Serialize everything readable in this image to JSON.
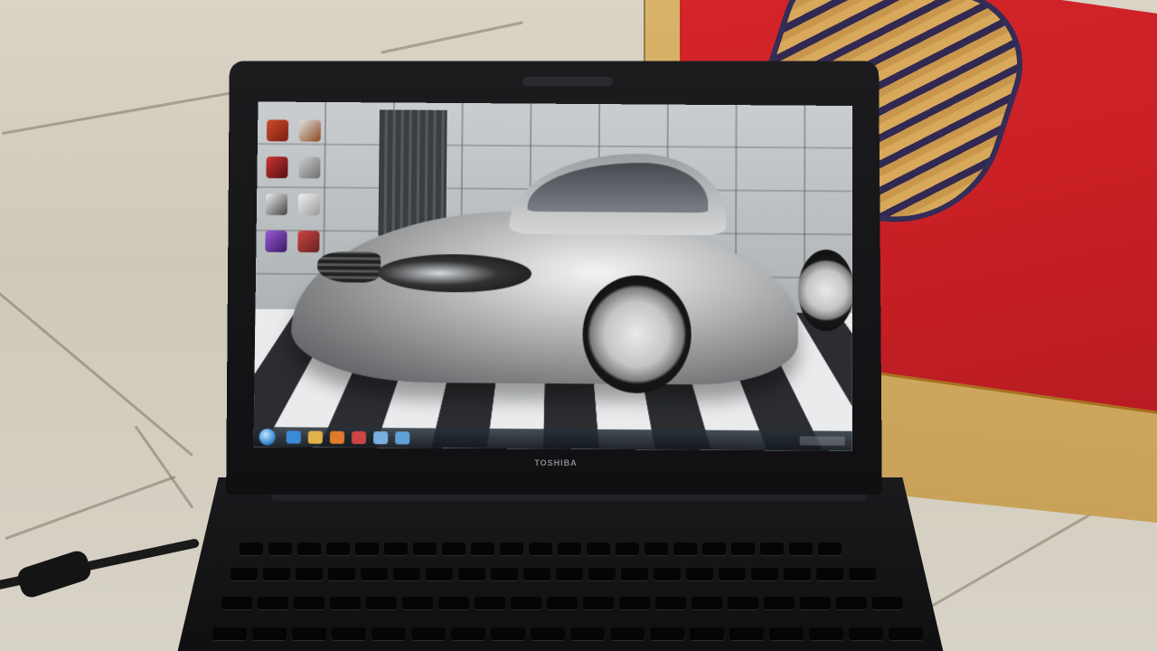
{
  "photo": {
    "subject": "laptop-displaying-car-wallpaper",
    "laptop_brand_text": "TOSHIBA"
  },
  "colors": {
    "box_red": "#c81f25",
    "box_tan": "#d2ad63",
    "floor": "#d4cfc2",
    "laptop_black": "#141416",
    "car_silver": "#b9babb",
    "taskbar": "#1c232b"
  },
  "desktop": {
    "icons": [
      "app-icon",
      "app-icon",
      "app-icon",
      "app-icon",
      "app-icon",
      "app-icon",
      "app-icon",
      "app-icon"
    ],
    "taskbar_items": [
      "start-orb-icon",
      "ie-icon",
      "explorer-icon",
      "media-icon",
      "app-icon",
      "app-icon",
      "app-icon"
    ]
  }
}
